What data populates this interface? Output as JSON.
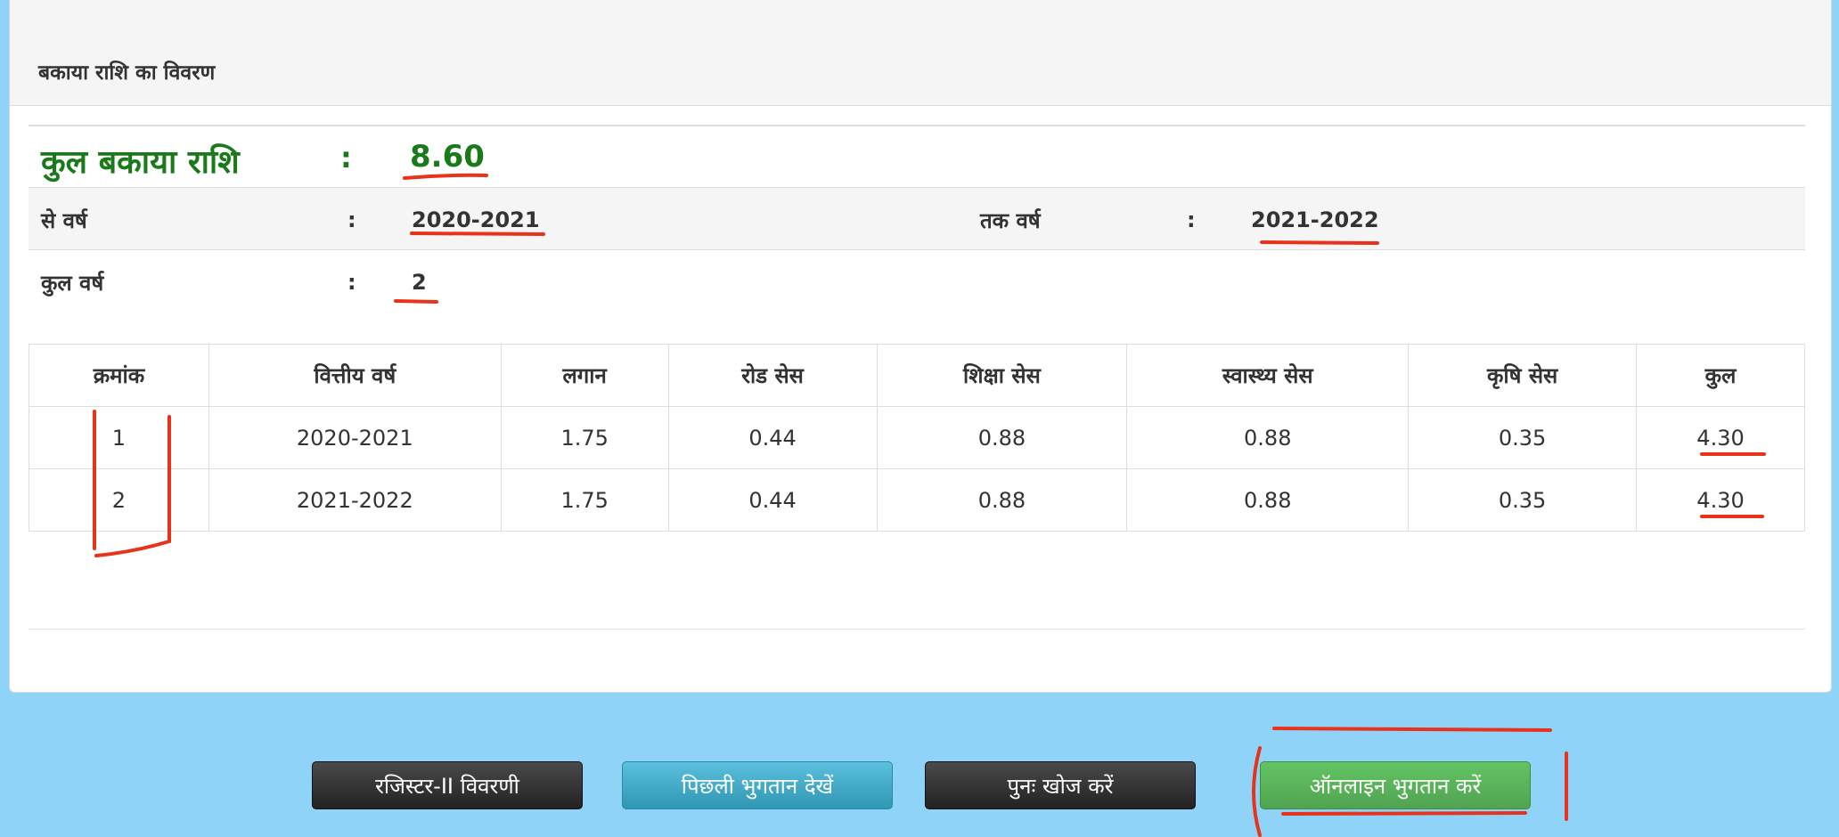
{
  "panel": {
    "title": "बकाया राशि का विवरण"
  },
  "summary": {
    "total_label": "कुल बकाया राशि",
    "colon": ":",
    "total_value": "8.60",
    "from_year_label": "से वर्ष",
    "from_year_value": "2020-2021",
    "to_year_label": "तक वर्ष",
    "to_year_value": "2021-2022",
    "total_years_label": "कुल वर्ष",
    "total_years_value": "2"
  },
  "table": {
    "headers": [
      "क्रमांक",
      "वित्तीय वर्ष",
      "लगान",
      "रोड सेस",
      "शिक्षा सेस",
      "स्वास्थ्य सेस",
      "कृषि सेस",
      "कुल"
    ],
    "rows": [
      [
        "1",
        "2020-2021",
        "1.75",
        "0.44",
        "0.88",
        "0.88",
        "0.35",
        "4.30"
      ],
      [
        "2",
        "2021-2022",
        "1.75",
        "0.44",
        "0.88",
        "0.88",
        "0.35",
        "4.30"
      ]
    ]
  },
  "buttons": {
    "register": "रजिस्टर-II विवरणी",
    "previous_payment": "पिछली भुगतान देखें",
    "search_again": "पुनः खोज करें",
    "online_payment": "ऑनलाइन भुगतान करें"
  },
  "colors": {
    "background": "#8fd3f8",
    "total_green": "#1a7a1a",
    "annotation_red": "#e8331c"
  }
}
